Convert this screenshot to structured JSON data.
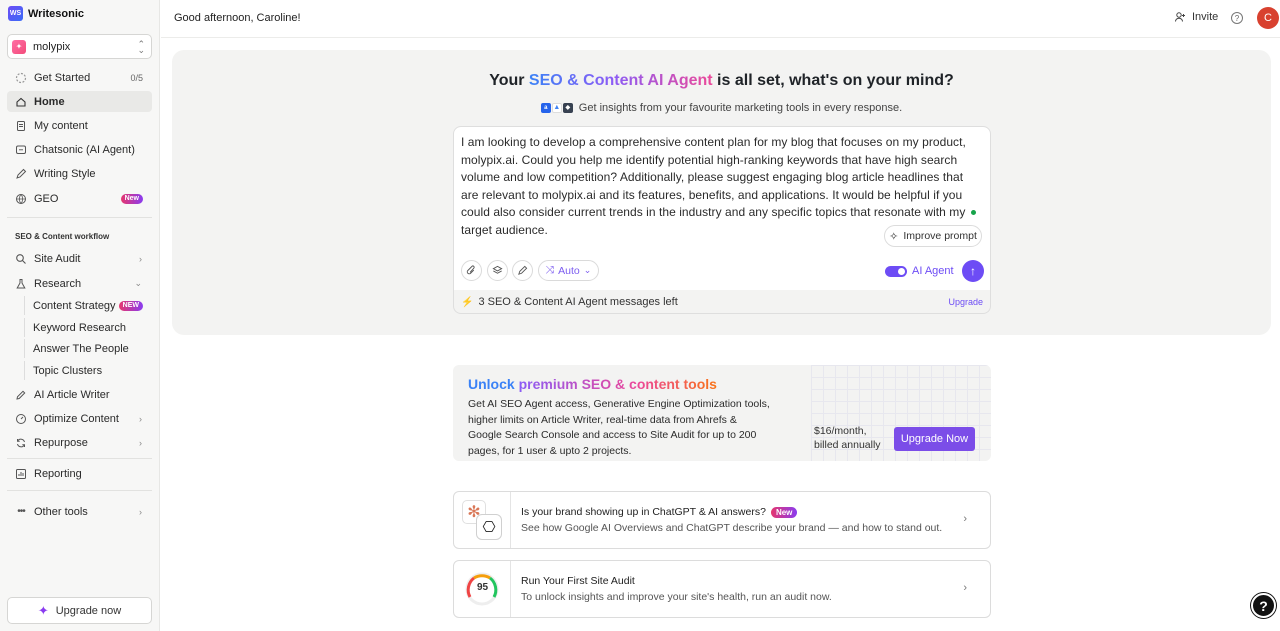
{
  "brand": {
    "name": "Writesonic",
    "logo_text": "WS"
  },
  "workspace": {
    "name": "molypix"
  },
  "sidebar": {
    "get_started": {
      "label": "Get Started",
      "progress": "0/5"
    },
    "items": [
      {
        "label": "Home"
      },
      {
        "label": "My content"
      },
      {
        "label": "Chatsonic (AI Agent)"
      },
      {
        "label": "Writing Style"
      },
      {
        "label": "GEO",
        "badge": "New"
      }
    ],
    "section_title": "SEO & Content workflow",
    "workflow": [
      {
        "label": "Site Audit"
      },
      {
        "label": "Research"
      },
      {
        "label": "AI Article Writer"
      },
      {
        "label": "Optimize Content"
      },
      {
        "label": "Repurpose"
      }
    ],
    "research_sub": [
      {
        "label": "Content Strategy",
        "badge": "NEW"
      },
      {
        "label": "Keyword Research"
      },
      {
        "label": "Answer The People"
      },
      {
        "label": "Topic Clusters"
      }
    ],
    "reporting": "Reporting",
    "other_tools": "Other tools",
    "upgrade_button": "Upgrade now"
  },
  "header": {
    "greeting": "Good afternoon, Caroline!",
    "invite": "Invite",
    "avatar_initial": "C"
  },
  "hero": {
    "title_pre": "Your ",
    "title_highlight": "SEO & Content AI Agent",
    "title_post": " is all set, what's on your mind?",
    "subtitle": "Get insights from your favourite marketing tools in every response.",
    "prompt": "I am looking to develop a comprehensive content plan for my blog that focuses on my product, molypix.ai. Could you help me identify potential high-ranking keywords that have high search volume and low competition? Additionally, please suggest engaging blog article headlines that are relevant to molypix.ai and its features, benefits, and applications. It would be helpful if you could also consider current trends in the industry and any specific topics that resonate with my target audience.",
    "improve_prompt": "Improve prompt",
    "mode": "Auto",
    "agent_toggle_label": "AI Agent",
    "agent_enabled": true,
    "quota_text": "3 SEO & Content AI Agent messages left",
    "quota_upgrade": "Upgrade"
  },
  "premium": {
    "title_part1": "Unlock ",
    "title_part2": "premium SEO & content tools",
    "description": "Get AI SEO Agent access, Generative Engine Optimization tools, higher limits on Article Writer, real-time data from Ahrefs & Google Search Console and access to Site Audit for up to 200 pages, for 1 user & upto 2 projects.",
    "price_line1": "$16/month,",
    "price_line2": "billed annually",
    "cta": "Upgrade Now"
  },
  "cards": [
    {
      "title": "Is your brand showing up in ChatGPT & AI answers?",
      "badge": "New",
      "description": "See how Google AI Overviews and ChatGPT describe your brand — and how to stand out."
    },
    {
      "title": "Run Your First Site Audit",
      "score": "95",
      "description": "To unlock insights and improve your site's health, run an audit now."
    }
  ],
  "colors": {
    "accent": "#6d4cf5",
    "cta": "#7b4de8",
    "avatar": "#d8412f"
  },
  "icons": [
    "home-icon",
    "document-icon",
    "chat-icon",
    "pen-icon",
    "globe-icon",
    "search-icon",
    "flask-icon",
    "pencil-icon",
    "gauge-icon",
    "refresh-icon",
    "chart-icon",
    "dots-icon",
    "sparkle-icon",
    "paperclip-icon",
    "layers-icon",
    "brush-icon",
    "arrow-up-icon",
    "help-icon",
    "user-plus-icon"
  ]
}
